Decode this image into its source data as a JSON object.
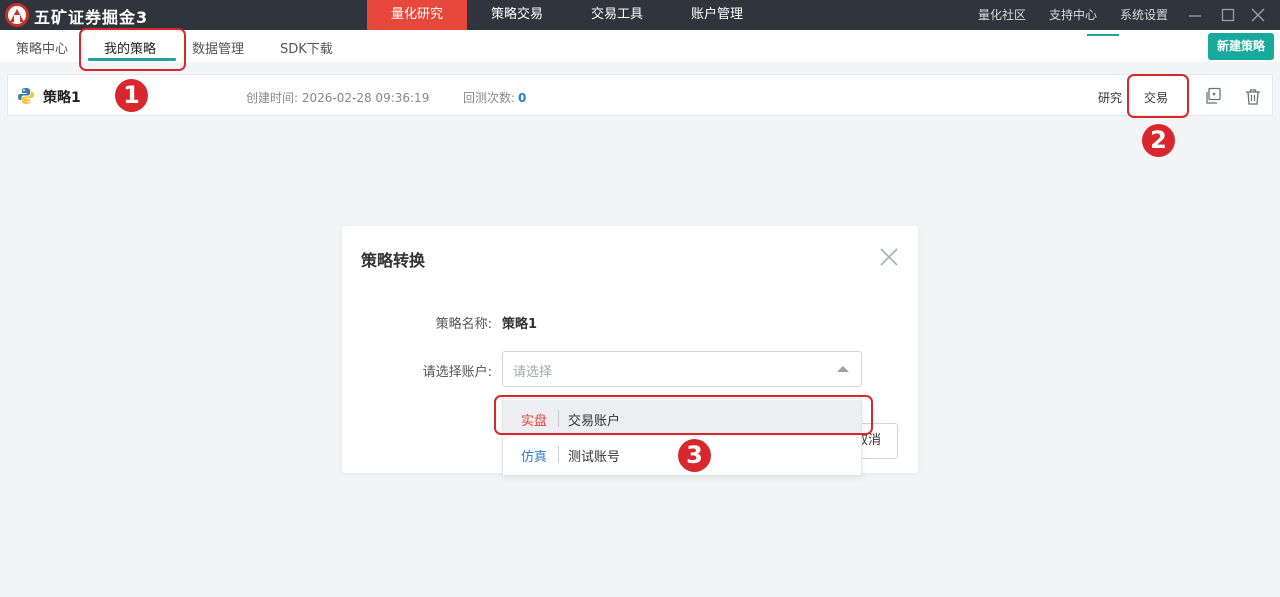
{
  "app": {
    "title": "五矿证券掘金3"
  },
  "top_nav": [
    {
      "label": "量化研究",
      "active": true
    },
    {
      "label": "策略交易",
      "active": false
    },
    {
      "label": "交易工具",
      "active": false
    },
    {
      "label": "账户管理",
      "active": false
    }
  ],
  "right_links": [
    "量化社区",
    "支持中心",
    "系统设置"
  ],
  "sub_tabs": [
    {
      "label": "策略中心",
      "active": false
    },
    {
      "label": "我的策略",
      "active": true
    },
    {
      "label": "数据管理",
      "active": false
    },
    {
      "label": "SDK下载",
      "active": false
    }
  ],
  "new_strategy_label": "新建策略",
  "strategy": {
    "name": "策略1",
    "created_label": "创建时间:",
    "created_at": "2026-02-28 09:36:19",
    "backtest_label": "回测次数:",
    "backtest_count": "0",
    "research_label": "研究",
    "trade_label": "交易"
  },
  "dialog": {
    "title": "策略转换",
    "name_label": "策略名称:",
    "name_value": "策略1",
    "account_label": "请选择账户:",
    "account_placeholder": "请选择",
    "cancel_label": "取消"
  },
  "dropdown_options": [
    {
      "tag": "实盘",
      "name": "交易账户",
      "tag_color": "#e0463c"
    },
    {
      "tag": "仿真",
      "name": "测试账号",
      "tag_color": "#2a7fd4"
    }
  ],
  "markers": [
    "1",
    "2",
    "3"
  ],
  "colors": {
    "accent_red": "#e8483b",
    "teal": "#16a99c",
    "marker_red": "#d9272e",
    "titlebar": "#2f343d"
  }
}
